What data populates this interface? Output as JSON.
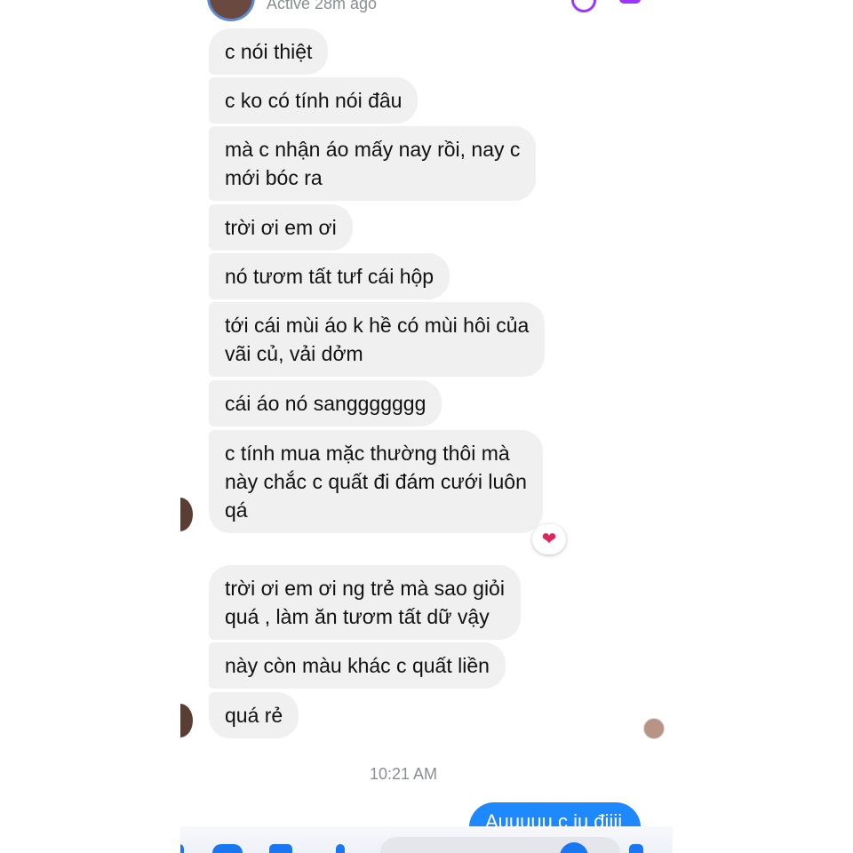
{
  "header": {
    "status": "Active 28m ago"
  },
  "messages": [
    {
      "text": "c nói thiệt"
    },
    {
      "text": "c ko có tính nói đâu"
    },
    {
      "text": "mà c nhận áo mấy nay rồi, nay c\nmới bóc ra"
    },
    {
      "text": "trời ơi em ơi"
    },
    {
      "text": "nó tươm tất tưf cái hộp"
    },
    {
      "text": "tới cái mùi áo k hề có mùi hôi của\nvãi củ, vải dởm"
    },
    {
      "text": "cái áo nó sanggggggg"
    },
    {
      "text": "c tính mua mặc thường thôi mà\nnày chắc c quất đi đám cưới luôn\nqá"
    },
    {
      "text": "trời ơi em ơi ng trẻ mà sao giỏi\nquá , làm ăn tươm tất dữ vậy"
    },
    {
      "text": "này còn màu khác c quất liền"
    },
    {
      "text": "quá rẻ"
    }
  ],
  "reaction": {
    "emoji": "❤"
  },
  "timestamp": "10:21 AM",
  "sent": {
    "text": "Auuuuu c iu điiii"
  },
  "colors": {
    "received_bubble": "#f0f0f0",
    "sent_bubble": "#1e88ff",
    "accent": "#a033ff",
    "composer_icons": "#1977f2"
  }
}
